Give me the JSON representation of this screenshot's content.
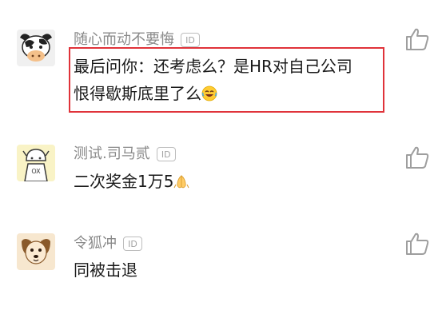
{
  "comments": [
    {
      "username": "随心而动不要悔",
      "id_badge": "ID",
      "lines": [
        "最后问你：还考虑么？是HR对自己公司",
        "恨得歇斯底里了么"
      ],
      "avatar": "cow-avatar",
      "emoji": "grinning-sweat-emoji",
      "highlighted": true
    },
    {
      "username": "测试.司马贰",
      "id_badge": "ID",
      "lines": [
        "二次奖金1万5"
      ],
      "avatar": "ox-hat-avatar",
      "emoji": "folded-hands-emoji"
    },
    {
      "username": "令狐冲",
      "id_badge": "ID",
      "lines": [
        "同被击退"
      ],
      "avatar": "dog-avatar"
    }
  ],
  "colors": {
    "username": "#8a8a8a",
    "text": "#1a1a1a",
    "highlight_border": "#e0333a",
    "icon": "#9e9e9e"
  }
}
